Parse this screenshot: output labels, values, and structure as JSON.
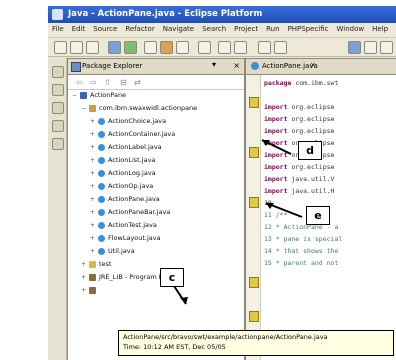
{
  "window": {
    "title": "Java - ActionPane.java - Eclipse Platform"
  },
  "menu": [
    "File",
    "Edit",
    "Source",
    "Refactor",
    "Navigate",
    "Search",
    "Project",
    "Run",
    "PHPSpecific",
    "Window",
    "Help"
  ],
  "explorer": {
    "tab_label": "Package Explorer",
    "close": "×",
    "minimize": "▾",
    "tree": [
      {
        "indent": 0,
        "toggle": "−",
        "icon": "proj",
        "label": "ActionPane"
      },
      {
        "indent": 1,
        "toggle": "−",
        "icon": "pkg",
        "label": "com.ibm.swaxwidl.actionpane"
      },
      {
        "indent": 2,
        "toggle": "+",
        "icon": "java",
        "label": "ActionChoice.java"
      },
      {
        "indent": 2,
        "toggle": "+",
        "icon": "java",
        "label": "ActionContainer.java"
      },
      {
        "indent": 2,
        "toggle": "+",
        "icon": "java",
        "label": "ActionLabel.java"
      },
      {
        "indent": 2,
        "toggle": "+",
        "icon": "java",
        "label": "ActionList.java"
      },
      {
        "indent": 2,
        "toggle": "+",
        "icon": "java",
        "label": "ActionLog.java"
      },
      {
        "indent": 2,
        "toggle": "+",
        "icon": "java",
        "label": "ActionOp.java"
      },
      {
        "indent": 2,
        "toggle": "+",
        "icon": "java",
        "label": "ActionPane.java"
      },
      {
        "indent": 2,
        "toggle": "+",
        "icon": "java",
        "label": "ActionPaneBar.java"
      },
      {
        "indent": 2,
        "toggle": "+",
        "icon": "java",
        "label": "ActionTest.java"
      },
      {
        "indent": 2,
        "toggle": "+",
        "icon": "java",
        "label": "FlowLayout.java"
      },
      {
        "indent": 2,
        "toggle": "+",
        "icon": "java",
        "label": "Util.java"
      },
      {
        "indent": 1,
        "toggle": "+",
        "icon": "folder",
        "label": "test"
      },
      {
        "indent": 1,
        "toggle": "+",
        "icon": "lib",
        "label": "JRE_LIB - Program Files/Jp"
      },
      {
        "indent": 1,
        "toggle": "+",
        "icon": "lib",
        "label": ""
      }
    ]
  },
  "editor": {
    "tab_label": "ActionPane.java",
    "close": "×",
    "lines": [
      {
        "kw": "package",
        "text": " com.ibm.swt"
      },
      {
        "kw": "",
        "text": ""
      },
      {
        "kw": "import",
        "text": " org.eclipse"
      },
      {
        "kw": "import",
        "text": " org.eclipse"
      },
      {
        "kw": "import",
        "text": " org.eclipse"
      },
      {
        "kw": "import",
        "text": " org.eclipse"
      },
      {
        "kw": "import",
        "text": " org.eclipse"
      },
      {
        "kw": "import",
        "text": " org.eclipse"
      },
      {
        "kw": "import",
        "text": " java.util.V"
      },
      {
        "kw": "import",
        "text": " java.util.H"
      },
      {
        "kw": "",
        "text": "10"
      },
      {
        "kw": "",
        "text": "11 /**",
        "comment": true
      },
      {
        "kw": "",
        "text": "12  * ActionPane - a",
        "comment": true
      },
      {
        "kw": "",
        "text": "13  * pane is special",
        "comment": true
      },
      {
        "kw": "",
        "text": "14  * that shows the",
        "comment": true
      },
      {
        "kw": "",
        "text": "15  * parent and not",
        "comment": true
      }
    ]
  },
  "callouts": {
    "c": "c",
    "d": "d",
    "e": "e"
  },
  "tooltip": {
    "line1": "ActionPane/src/bravo/swt/example/actionpane/ActionPane.java",
    "line2": "Time: 10:12 AM EST, Dec 05/05"
  }
}
